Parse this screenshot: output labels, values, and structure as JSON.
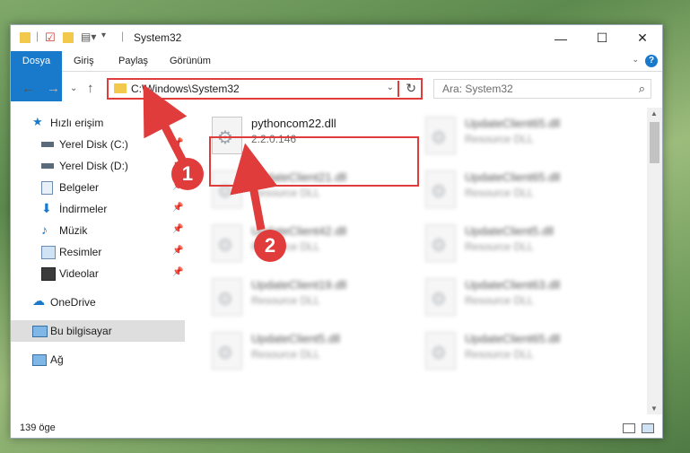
{
  "window": {
    "title": "System32",
    "controls": {
      "minimize": "—",
      "maximize": "☐",
      "close": "✕"
    }
  },
  "ribbon": {
    "tabs": [
      "Dosya",
      "Giriş",
      "Paylaş",
      "Görünüm"
    ],
    "help": "?"
  },
  "navigation": {
    "address": "C:\\Windows\\System32",
    "search_placeholder": "Ara: System32"
  },
  "sidebar": {
    "items": [
      {
        "label": "Hızlı erişim",
        "icon": "star-icon"
      },
      {
        "label": "Yerel Disk (C:)",
        "icon": "drive-icon"
      },
      {
        "label": "Yerel Disk (D:)",
        "icon": "drive-icon"
      },
      {
        "label": "Belgeler",
        "icon": "documents-icon"
      },
      {
        "label": "İndirmeler",
        "icon": "download-icon"
      },
      {
        "label": "Müzik",
        "icon": "music-icon"
      },
      {
        "label": "Resimler",
        "icon": "pictures-icon"
      },
      {
        "label": "Videolar",
        "icon": "video-icon"
      },
      {
        "label": "OneDrive",
        "icon": "cloud-icon"
      },
      {
        "label": "Bu bilgisayar",
        "icon": "computer-icon"
      },
      {
        "label": "Ağ",
        "icon": "network-icon"
      }
    ]
  },
  "files": [
    {
      "name": "pythoncom22.dll",
      "desc": "2.2.0.146"
    },
    {
      "name": "UpdateClient65.dll",
      "desc": "Resource DLL"
    },
    {
      "name": "UpdateClient21.dll",
      "desc": "Resource DLL"
    },
    {
      "name": "UpdateClient65.dll",
      "desc": "Resource DLL"
    },
    {
      "name": "UpdateClient42.dll",
      "desc": "Resource DLL"
    },
    {
      "name": "UpdateClient5.dll",
      "desc": "Resource DLL"
    },
    {
      "name": "UpdateClient19.dll",
      "desc": "Resource DLL"
    },
    {
      "name": "UpdateClient63.dll",
      "desc": "Resource DLL"
    },
    {
      "name": "UpdateClient5.dll",
      "desc": "Resource DLL"
    },
    {
      "name": "UpdateClient65.dll",
      "desc": "Resource DLL"
    }
  ],
  "status": {
    "count": "139 öge"
  },
  "annotations": {
    "step1": "1",
    "step2": "2"
  }
}
